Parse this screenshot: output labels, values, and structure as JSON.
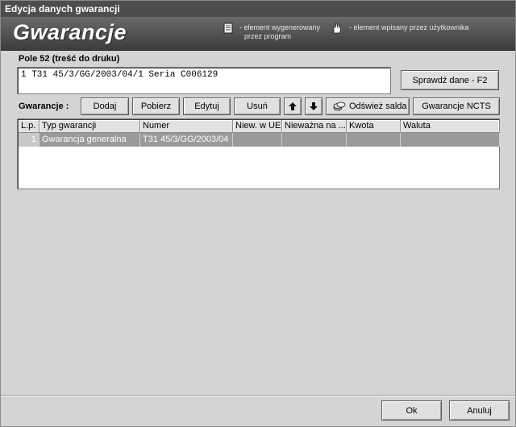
{
  "window": {
    "title": "Edycja danych gwarancji"
  },
  "banner": {
    "logo_text": "Gwarancje",
    "legend_generated_line1": "- element wygenerowany",
    "legend_generated_line2": "przez program",
    "legend_generated_icon": "document-icon",
    "legend_user_text": "- element wpisany przez użytkownika",
    "legend_user_icon": "hand-icon"
  },
  "field52": {
    "label": "Pole 52 (treść do druku)",
    "value": "1 T31 45/3/GG/2003/04/1 Seria C006129",
    "check_button": "Sprawdź dane - F2"
  },
  "toolbar": {
    "label": "Gwarancje :",
    "add": "Dodaj",
    "fetch": "Pobierz",
    "edit": "Edytuj",
    "delete": "Usuń",
    "up_icon": "arrow-up-icon",
    "down_icon": "arrow-down-icon",
    "refresh": "Odśwież salda",
    "ncts": "Gwarancje NCTS"
  },
  "table": {
    "columns": [
      "L.p.",
      "Typ gwarancji",
      "Numer",
      "Niew. w UE",
      "Nieważna na ...",
      "Kwota",
      "Waluta"
    ],
    "rows": [
      {
        "lp": "1",
        "type": "Gwarancja generalna",
        "number": "T31 45/3/GG/2003/04",
        "invalid_eu": "",
        "invalid_on": "",
        "amount": "",
        "currency": ""
      }
    ]
  },
  "footer": {
    "ok": "Ok",
    "cancel": "Anuluj"
  },
  "colors": {
    "title_bar": "#4d4d4d",
    "selected_row": "#9a9a9a",
    "window_bg": "#d4d4d4"
  }
}
